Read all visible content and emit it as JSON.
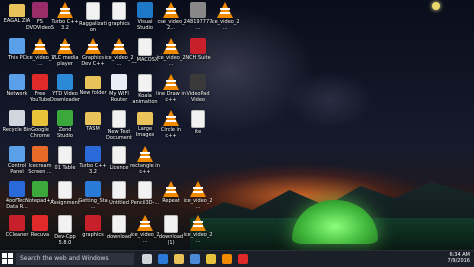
{
  "desktop": {
    "icons": [
      {
        "label": "EAGAL ZIA",
        "icon": "user-folder-icon",
        "color": "#e9c25a"
      },
      {
        "label": "FS DVDVideoSoft Free Studio",
        "icon": "freestudio-icon",
        "color": "#9a2c6a"
      },
      {
        "label": "Turbo C++ 3.2",
        "icon": "vlc-icon",
        "color": "#f08a00"
      },
      {
        "label": "Raggalization",
        "icon": "doc-icon",
        "color": "#f2f2f2"
      },
      {
        "label": "graphics",
        "icon": "doc-icon",
        "color": "#f2f2f2"
      },
      {
        "label": "Visual Studio Code",
        "icon": "vscode-icon",
        "color": "#1e78c8"
      },
      {
        "label": "cse_video_2...",
        "icon": "vlc-icon",
        "color": "#f08a00"
      },
      {
        "label": "248197777...",
        "icon": "image-icon",
        "color": "#888888"
      },
      {
        "label": "ice_video_2...",
        "icon": "vlc-icon",
        "color": "#f08a00"
      },
      {
        "label": "This PC",
        "icon": "computer-icon",
        "color": "#5aa0e8"
      },
      {
        "label": "ice_video_2...",
        "icon": "vlc-icon",
        "color": "#f08a00"
      },
      {
        "label": "VLC media player",
        "icon": "vlc-icon",
        "color": "#f08a00"
      },
      {
        "label": "Graphics Dev C++",
        "icon": "vlc-icon",
        "color": "#f08a00"
      },
      {
        "label": "ice_video_2...",
        "icon": "vlc-icon",
        "color": "#f08a00"
      },
      {
        "label": "__MACOSX",
        "icon": "doc-icon",
        "color": "#f2f2f2"
      },
      {
        "label": "ice_video_2...",
        "icon": "vlc-icon",
        "color": "#f08a00"
      },
      {
        "label": "NCH Suite",
        "icon": "nch-icon",
        "color": "#c8202a"
      },
      {
        "label": "Network",
        "icon": "network-icon",
        "color": "#5aa0e8"
      },
      {
        "label": "Free YouTube Download",
        "icon": "youtube-icon",
        "color": "#e02a2a"
      },
      {
        "label": "YTD Video Downloader",
        "icon": "ytd-icon",
        "color": "#2a8ad8"
      },
      {
        "label": "New folder",
        "icon": "folder-icon",
        "color": "#e9c25a"
      },
      {
        "label": "My WIFI Router",
        "icon": "wifi-icon",
        "color": "#e8eef5"
      },
      {
        "label": "Koala animation",
        "icon": "doc-icon",
        "color": "#f2f2f2"
      },
      {
        "label": "line Draw in c++",
        "icon": "vlc-icon",
        "color": "#f08a00"
      },
      {
        "label": "VideoPad Video Editor",
        "icon": "videopad-icon",
        "color": "#3a3a3a"
      },
      {
        "label": "Recycle Bin",
        "icon": "recycle-bin-icon",
        "color": "#cfd6de"
      },
      {
        "label": "Google Chrome",
        "icon": "chrome-icon",
        "color": "#e8c23a"
      },
      {
        "label": "Zend Studio",
        "icon": "zend-icon",
        "color": "#3aa83a"
      },
      {
        "label": "TASM",
        "icon": "folder-icon",
        "color": "#e9c25a"
      },
      {
        "label": "New Text Document",
        "icon": "doc-icon",
        "color": "#f2f2f2"
      },
      {
        "label": "Large Images",
        "icon": "folder-icon",
        "color": "#e9c25a"
      },
      {
        "label": "Circle in c++",
        "icon": "vlc-icon",
        "color": "#f08a00"
      },
      {
        "label": "ite",
        "icon": "doc-icon",
        "color": "#f2f2f2"
      },
      {
        "label": "Control Panel",
        "icon": "control-panel-icon",
        "color": "#5aa0e8"
      },
      {
        "label": "Icecream Screen ...",
        "icon": "icecream-icon",
        "color": "#e86a2a"
      },
      {
        "label": "01 Table",
        "icon": "doc-icon",
        "color": "#f2f2f2"
      },
      {
        "label": "Turbo C++ 3.2",
        "icon": "turbo-icon",
        "color": "#2a6ad8"
      },
      {
        "label": "Licence",
        "icon": "doc-icon",
        "color": "#f2f2f2"
      },
      {
        "label": "rectangle in c++",
        "icon": "vlc-icon",
        "color": "#f08a00"
      },
      {
        "label": "4oofTech Data R...",
        "icon": "datarecovery-icon",
        "color": "#2a6ad8"
      },
      {
        "label": "Notepad++",
        "icon": "notepad-icon",
        "color": "#3aa83a"
      },
      {
        "label": "Assignment",
        "icon": "doc-icon",
        "color": "#f2f2f2"
      },
      {
        "label": "Getting_Sta...",
        "icon": "edge-icon",
        "color": "#2a7ad8"
      },
      {
        "label": "Untitled",
        "icon": "doc-icon",
        "color": "#f2f2f2"
      },
      {
        "label": "Pencil3D-...",
        "icon": "doc-icon",
        "color": "#f2f2f2"
      },
      {
        "label": "Repeat",
        "icon": "vlc-icon",
        "color": "#f08a00"
      },
      {
        "label": "ice_video_2...",
        "icon": "vlc-icon",
        "color": "#f08a00"
      },
      {
        "label": "CCleaner",
        "icon": "ccleaner-icon",
        "color": "#c8202a"
      },
      {
        "label": "Recuva",
        "icon": "recuva-icon",
        "color": "#e02a2a"
      },
      {
        "label": "Dev-Cpp 5.8.0 TDM...",
        "icon": "doc-icon",
        "color": "#f2f2f2"
      },
      {
        "label": "graphics",
        "icon": "graphics-icon",
        "color": "#c8202a"
      },
      {
        "label": "download",
        "icon": "doc-icon",
        "color": "#f2f2f2"
      },
      {
        "label": "ice_video_2...",
        "icon": "vlc-icon",
        "color": "#f08a00"
      },
      {
        "label": "download (1)",
        "icon": "doc-icon",
        "color": "#f2f2f2"
      },
      {
        "label": "ice_video_2...",
        "icon": "vlc-icon",
        "color": "#f08a00"
      }
    ]
  },
  "taskbar": {
    "search_placeholder": "Search the web and Windows",
    "pinned": [
      {
        "icon": "task-view-icon",
        "color": "#cfd3da"
      },
      {
        "icon": "edge-icon",
        "color": "#2a7ad8"
      },
      {
        "icon": "file-explorer-icon",
        "color": "#e9c25a"
      },
      {
        "icon": "store-icon",
        "color": "#4a8ad8"
      },
      {
        "icon": "chrome-icon",
        "color": "#e8c23a"
      },
      {
        "icon": "vlc-icon",
        "color": "#f08a00"
      },
      {
        "icon": "recorder-icon",
        "color": "#e02a2a"
      }
    ],
    "time": "6:34 AM",
    "date": "7/9/2016"
  }
}
